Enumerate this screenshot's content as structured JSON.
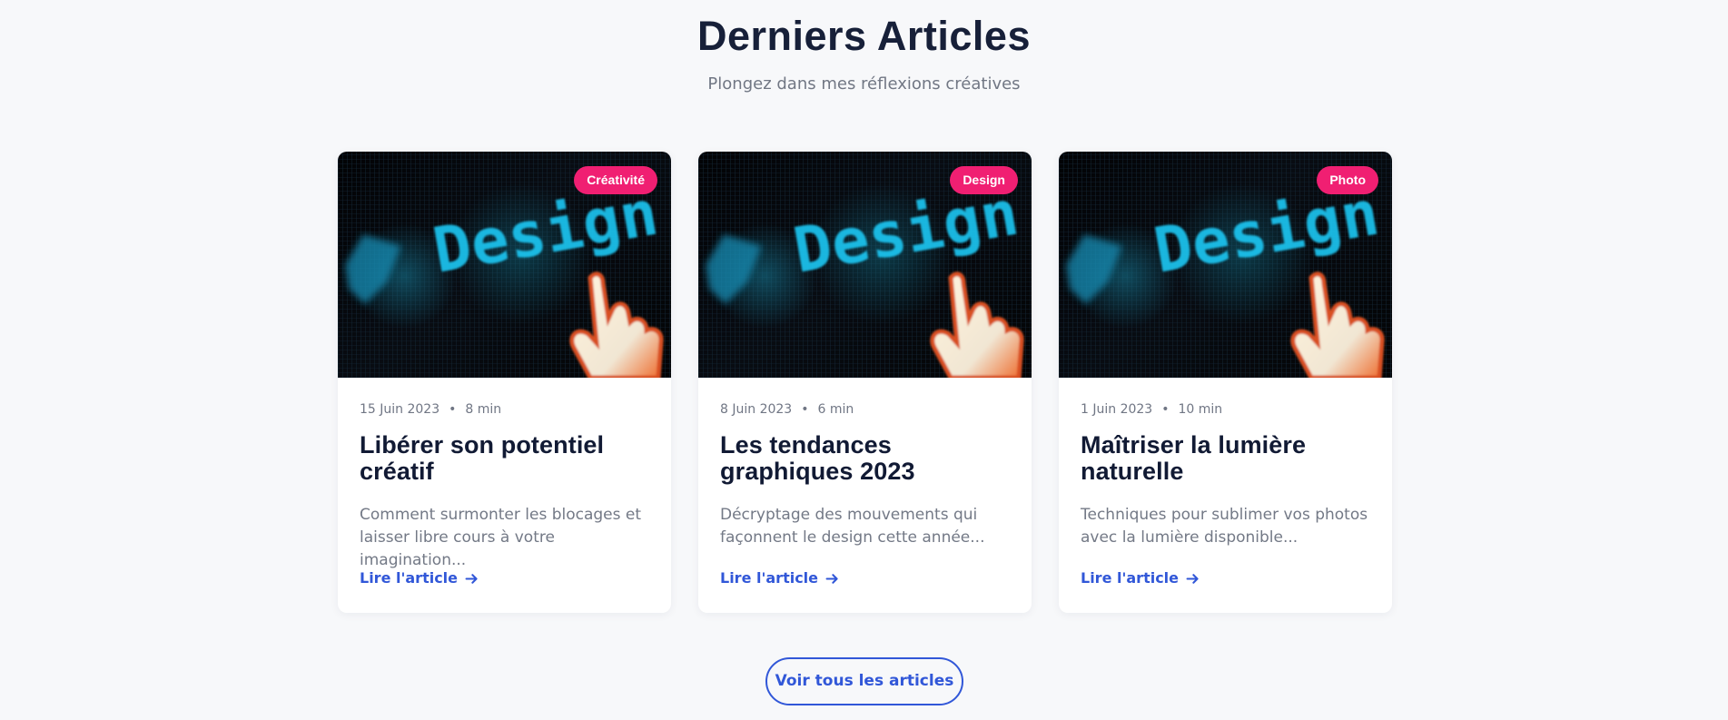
{
  "section": {
    "title": "Derniers Articles",
    "subtitle": "Plongez dans mes réflexions créatives"
  },
  "image": {
    "text": "Design",
    "icon": "pointer-hand-icon",
    "accent": "#22c9ff"
  },
  "articles": [
    {
      "category": "Créativité",
      "date": "15 Juin 2023",
      "separator": "•",
      "read_time": "8 min",
      "title": "Libérer son potentiel créatif",
      "excerpt": "Comment surmonter les blocages et laisser libre cours à votre imagination...",
      "link_label": "Lire l'article"
    },
    {
      "category": "Design",
      "date": "8 Juin 2023",
      "separator": "•",
      "read_time": "6 min",
      "title": "Les tendances graphiques 2023",
      "excerpt": "Décryptage des mouvements qui façonnent le design cette année...",
      "link_label": "Lire l'article"
    },
    {
      "category": "Photo",
      "date": "1 Juin 2023",
      "separator": "•",
      "read_time": "10 min",
      "title": "Maîtriser la lumière naturelle",
      "excerpt": "Techniques pour sublimer vos photos avec la lumière disponible...",
      "link_label": "Lire l'article"
    }
  ],
  "actions": {
    "view_all": "Voir tous les articles"
  },
  "colors": {
    "background": "#f7f8fa",
    "heading": "#172039",
    "muted": "#717784",
    "badge": "#f01f72",
    "link": "#3157d8"
  }
}
